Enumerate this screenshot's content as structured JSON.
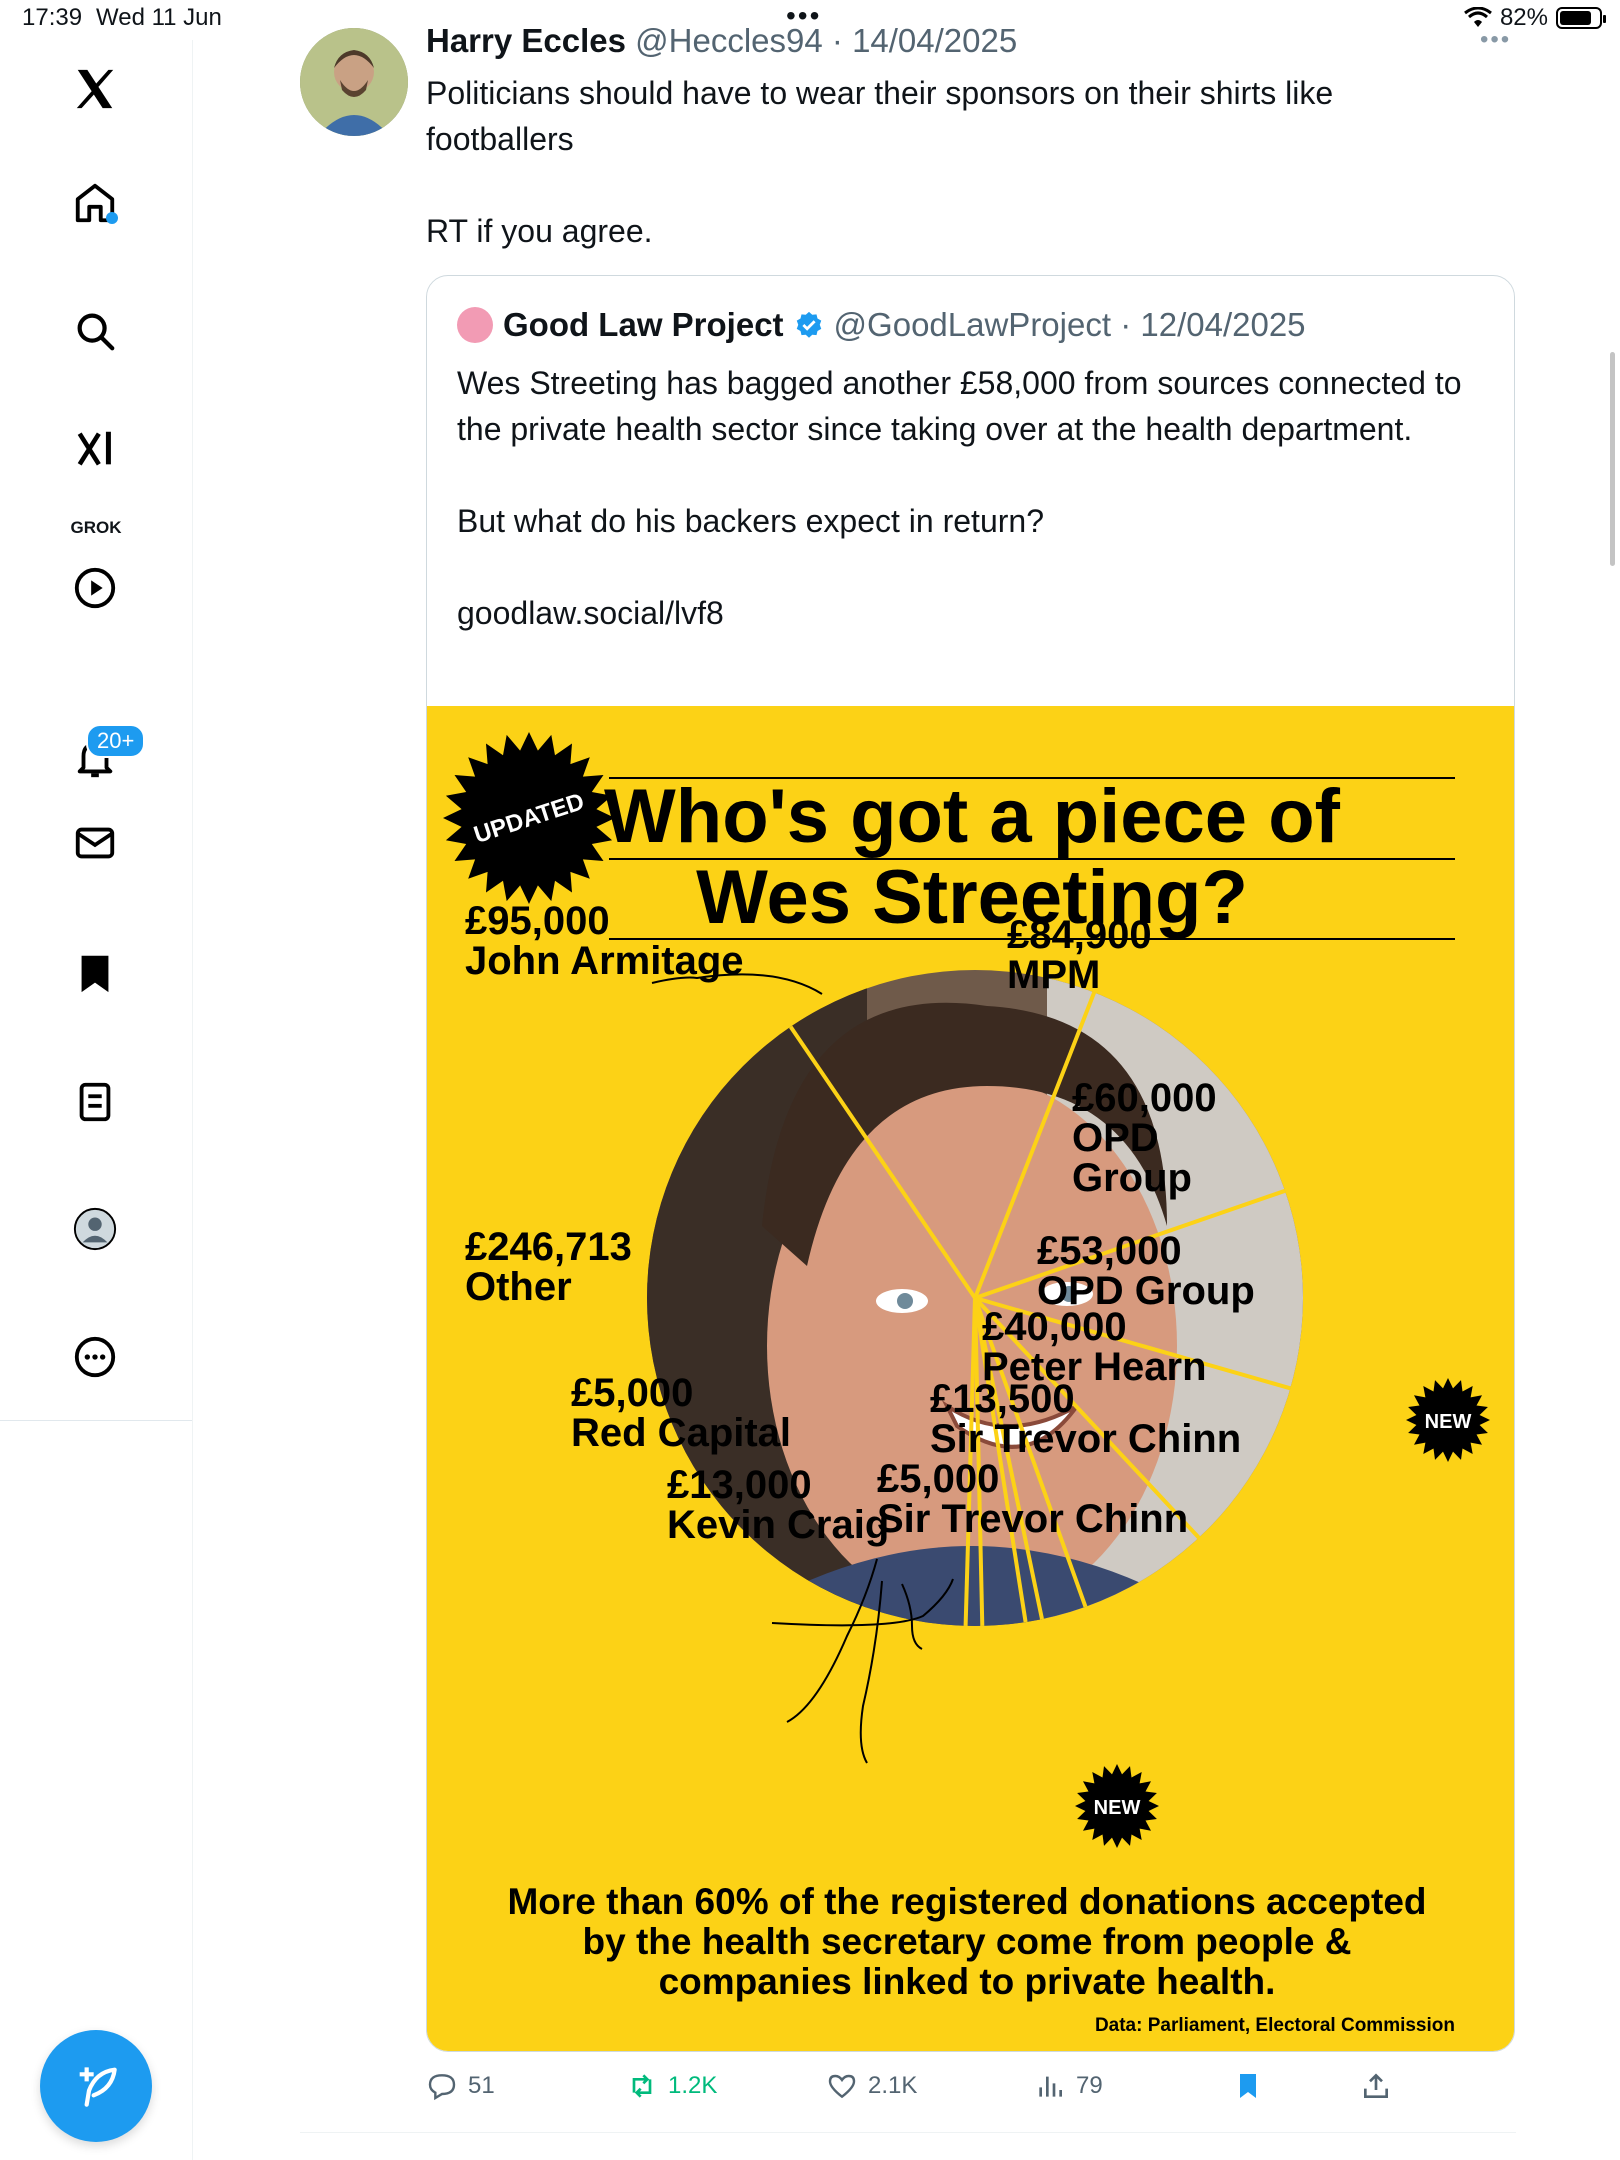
{
  "status_bar": {
    "time": "17:39",
    "date": "Wed 11 Jun",
    "battery": "82%",
    "battery_level": 0.82
  },
  "sidebar": {
    "items": [
      "home-icon",
      "search-icon",
      "grok-icon",
      "video-icon",
      "notifications-icon",
      "messages-icon",
      "bookmarks-icon",
      "lists-icon",
      "profile-icon",
      "more-icon"
    ],
    "grok_label": "GROK",
    "notifications_badge": "20+"
  },
  "tweet": {
    "author_name": "Harry Eccles",
    "author_handle": "@Heccles94",
    "date": "14/04/2025",
    "text": "Politicians should have to wear their sponsors on their shirts like footballers\n\nRT if you agree.",
    "quote": {
      "author_name": "Good Law Project",
      "author_handle": "@GoodLawProject",
      "date": "12/04/2025",
      "text": "Wes Streeting has bagged another £58,000 from sources connected to the private health sector since taking over at the health department.\n\nBut what do his backers expect in return?\n\ngoodlaw.social/lvf8"
    },
    "actions": {
      "replies": "51",
      "reposts": "1.2K",
      "likes": "2.1K",
      "views": "79"
    }
  },
  "graphic": {
    "badge": "UPDATED",
    "title_line1": "Who's got a piece of",
    "title_line2": "Wes Streeting?",
    "new_label": "NEW",
    "footer_line1": "More than 60% of the registered donations accepted",
    "footer_line2": "by the health secretary come from people &",
    "footer_line3": "companies linked to private health.",
    "source": "Data: Parliament, Electoral Commission",
    "labels": {
      "armitage_amount": "£95,000",
      "armitage_name": "John Armitage",
      "mpm_amount": "£84,900",
      "mpm_name": "MPM",
      "opd60_amount": "£60,000",
      "opd60_name1": "OPD",
      "opd60_name2": "Group",
      "opd53_amount": "£53,000",
      "opd53_name": "OPD Group",
      "hearn_amount": "£40,000",
      "hearn_name": "Peter Hearn",
      "chinn1_amount": "£13,500",
      "chinn1_name": "Sir Trevor Chinn",
      "red_amount": "£5,000",
      "red_name": "Red Capital",
      "craig_amount": "£13,000",
      "craig_name": "Kevin Craig",
      "chinn2_amount": "£5,000",
      "chinn2_name": "Sir Trevor Chinn",
      "other_amount": "£246,713",
      "other_name": "Other"
    }
  },
  "chart_data": {
    "type": "pie",
    "title": "Who's got a piece of Wes Streeting?",
    "categories": [
      "John Armitage",
      "MPM",
      "OPD Group",
      "OPD Group",
      "Peter Hearn",
      "Sir Trevor Chinn",
      "Sir Trevor Chinn",
      "Kevin Craig",
      "Red Capital",
      "Other"
    ],
    "values": [
      95000,
      84900,
      60000,
      53000,
      40000,
      13500,
      5000,
      13000,
      5000,
      246713
    ]
  }
}
